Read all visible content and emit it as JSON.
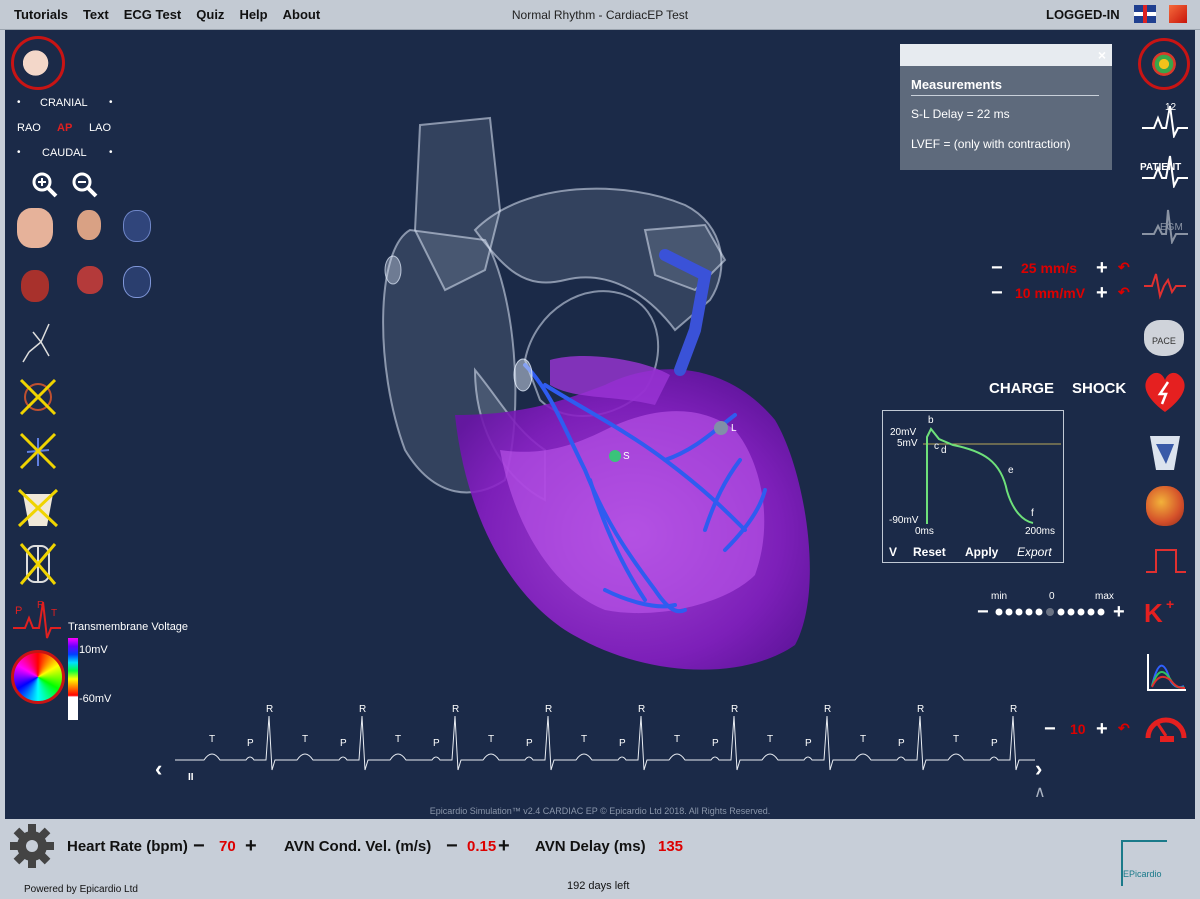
{
  "menu": [
    "Tutorials",
    "Text",
    "ECG Test",
    "Quiz",
    "Help",
    "About"
  ],
  "window_title": "Normal Rhythm - CardiacEP Test",
  "user_status": "LOGGED-IN",
  "view": {
    "cranial": "CRANIAL",
    "caudal": "CAUDAL",
    "rao": "RAO",
    "ap": "AP",
    "lao": "LAO",
    "dot": "•"
  },
  "measurements": {
    "close": "×",
    "title": "Measurements",
    "sl_delay": "S-L Delay = 22 ms",
    "lvef": "LVEF = (only with contraction)"
  },
  "ecg_scale": {
    "minus": "−",
    "plus": "+",
    "speed": "25 mm/s",
    "gain": "10 mm/mV",
    "undo": "↶"
  },
  "defib": {
    "charge": "CHARGE",
    "shock": "SHOCK"
  },
  "action_potential": {
    "v20": "20mV",
    "v5": "5mV",
    "vm90": "-90mV",
    "t0": "0ms",
    "t200": "200ms",
    "b": "b",
    "c": "c",
    "d": "d",
    "e": "e",
    "f": "f",
    "v_label": "V",
    "reset": "Reset",
    "apply": "Apply",
    "export": "Export"
  },
  "slider": {
    "min": "min",
    "zero": "0",
    "max": "max",
    "minus": "−",
    "plus": "+"
  },
  "legend": {
    "title": "Transmembrane Voltage",
    "high": "10mV",
    "low": "-60mV"
  },
  "heart_markers": {
    "s": "S",
    "l": "L"
  },
  "rhythm_strip": {
    "r_labels": [
      "R",
      "R",
      "R",
      "R",
      "R",
      "R",
      "R",
      "R",
      "R"
    ],
    "t_labels": [
      "T",
      "T",
      "T",
      "T",
      "T",
      "T",
      "T",
      "T",
      "T"
    ],
    "p_labels": [
      "P",
      "P",
      "P",
      "P",
      "P",
      "P",
      "P",
      "P",
      "P"
    ],
    "prev": "‹",
    "next": "›",
    "pause": "II",
    "up": "∧"
  },
  "bottom_counter": {
    "minus": "−",
    "value": "10",
    "plus": "+",
    "undo": "↶"
  },
  "copyright": "Epicardio Simulation™ v2.4 CARDIAC EP  © Epicardio Ltd 2018. All Rights Reserved.",
  "bottom": {
    "hr_label": "Heart Rate (bpm)",
    "hr_value": "70",
    "avn_vel_label": "AVN Cond. Vel. (m/s)",
    "avn_vel_value": "0.15",
    "avn_delay_label": "AVN Delay (ms)",
    "avn_delay_value": "135",
    "minus": "−",
    "plus": "+",
    "powered": "Powered by Epicardio Ltd",
    "days_left": "192 days left",
    "logo_text": "EPicardio"
  },
  "right_icons": {
    "twelve": "12",
    "patient": "PATIENT",
    "egm": "EGM",
    "pace": "PACE",
    "k": "K",
    "kplus": "+"
  }
}
